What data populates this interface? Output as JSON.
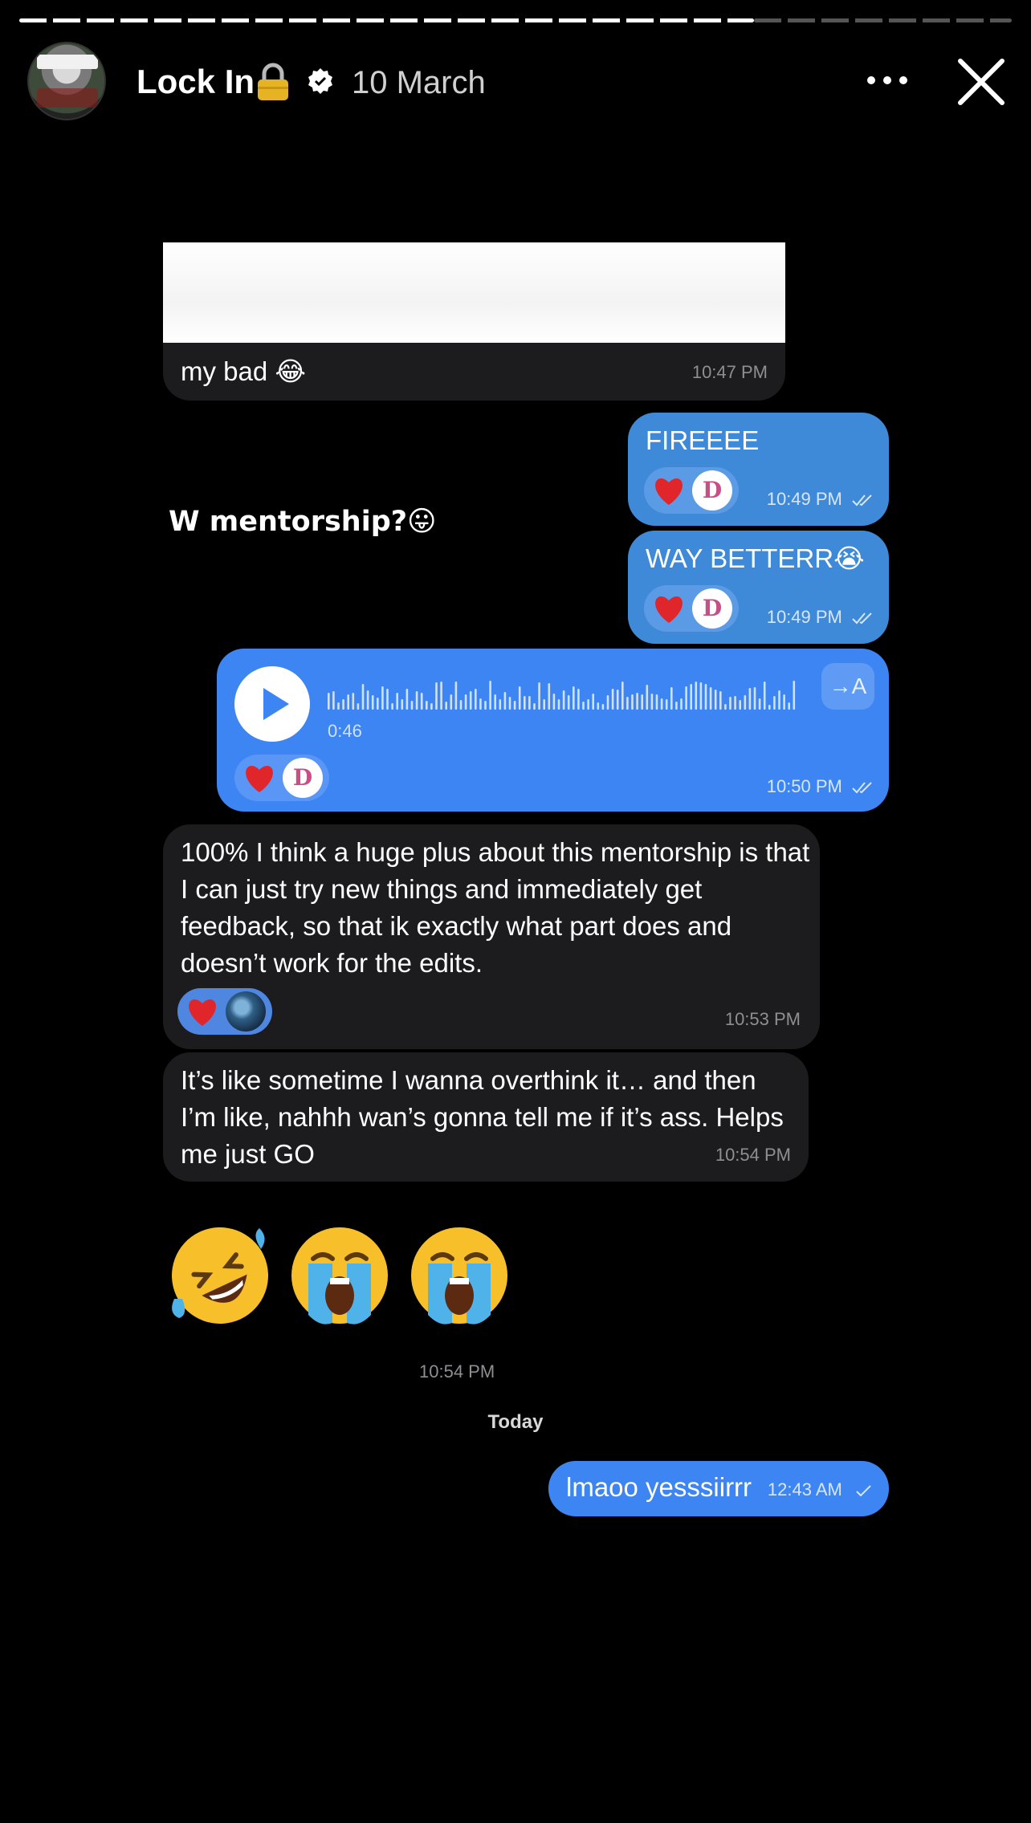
{
  "story": {
    "title": "Lock In",
    "date": "10 March",
    "progress": 0.74
  },
  "caption": "W mentorship?😛",
  "messages": {
    "m1": {
      "text": "my bad 😂",
      "time": "10:47 PM"
    },
    "m2": {
      "text": "FIREEEE",
      "time": "10:49 PM"
    },
    "m3": {
      "text": "WAY BETTERR😭",
      "time": "10:49 PM"
    },
    "voice": {
      "duration": "0:46",
      "translate": "→A",
      "time": "10:50 PM"
    },
    "m4": {
      "text": "100% I think a huge plus about this mentorship is that I can just try new things and immediately get feedback, so that ik exactly what part does and doesn’t work for the edits.",
      "time": "10:53 PM"
    },
    "m5": {
      "text": "It’s like sometime I wanna overthink it… and then I’m like, nahhh wan’s gonna tell me if it’s ass. Helps me just GO",
      "time": "10:54 PM"
    },
    "emoji_time": "10:54 PM",
    "day_separator": "Today",
    "m6": {
      "text": "lmaoo yesssiirrr",
      "time": "12:43 AM"
    }
  },
  "colors": {
    "incoming_bubble": "#1c1c1e",
    "outgoing_bubble": "#3f8ad8",
    "outgoing_bubble_bright": "#3c85f3",
    "reaction_pill": "#5a8fe0"
  },
  "icons": {
    "title_icon": "lock-icon",
    "badge": "verified-icon",
    "menu": "more-icon",
    "dismiss": "close-icon",
    "reaction": "heart-icon"
  }
}
